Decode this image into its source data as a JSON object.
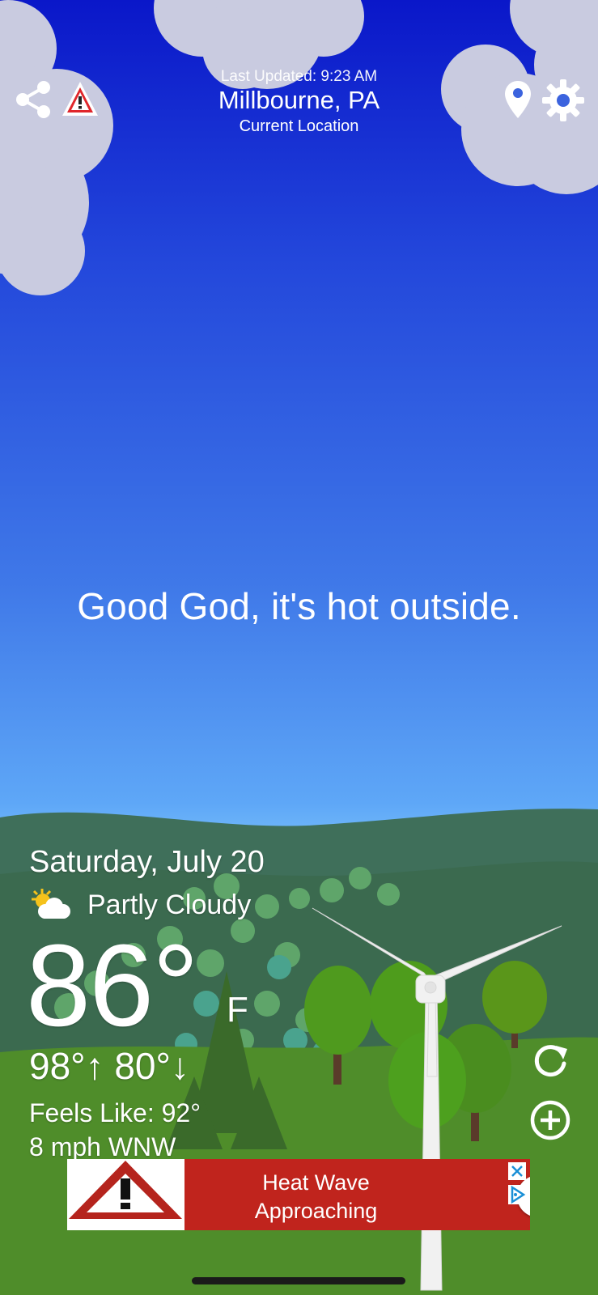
{
  "header": {
    "last_updated": "Last Updated: 9:23 AM",
    "city": "Millbourne, PA",
    "location_label": "Current Location"
  },
  "quip": "Good God, it's hot outside.",
  "weather": {
    "date": "Saturday, July 20",
    "condition": "Partly Cloudy",
    "temperature": "86°",
    "unit": "F",
    "high_low": "98°↑ 80°↓",
    "feels_like": "Feels Like: 92°",
    "wind": "8 mph WNW"
  },
  "banner": {
    "line1": "Heat Wave",
    "line2": "Approaching"
  },
  "colors": {
    "banner_red": "#c0241d",
    "grass": "#4f8d2a",
    "hills": "#3d6b57",
    "sky_top": "#0a17c9",
    "sky_bottom": "#79c0fb"
  },
  "icons": {
    "share": "share-icon",
    "alert": "alert-triangle-icon",
    "location": "location-pin-icon",
    "settings": "gear-icon",
    "condition": "partly-cloudy-icon",
    "refresh": "refresh-icon",
    "add": "add-circle-icon",
    "ad_close": "close-icon",
    "ad_choices": "ad-choices-icon"
  }
}
